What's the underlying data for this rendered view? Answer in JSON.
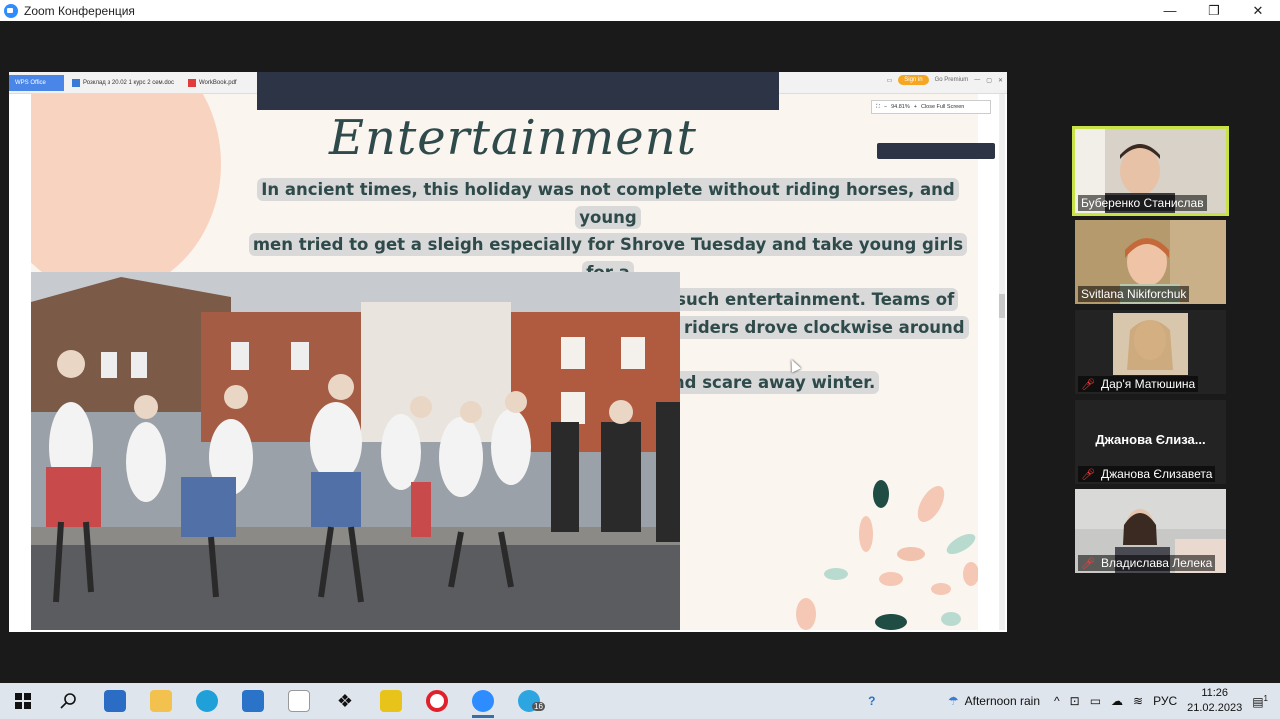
{
  "window": {
    "title": "Zoom Конференция",
    "controls": [
      "—",
      "❐",
      "✕"
    ]
  },
  "wps": {
    "tabs": [
      {
        "label": "WPS Office"
      },
      {
        "label": "Розклад з 20.02 1 курс 2 сем.doc"
      },
      {
        "label": "WorkBook.pdf"
      }
    ],
    "sign_in": "Sign in",
    "premium": "Go Premium",
    "zoom_level": "94.81%",
    "close_fullscreen": "Close Full Screen"
  },
  "slide": {
    "title": "Entertainment",
    "lines": [
      "In ancient times, this holiday was not complete without riding horses, and young",
      "men tried to get a sleigh especially for Shrove Tuesday and take young girls for a",
      "ride.  Young couples necessarily took part in such entertainment.  Teams of",
      "horses with bells and cheerful laughter of the riders drove clockwise around the",
      "villages, trying to wake up nature and scare away winter."
    ]
  },
  "participants": [
    {
      "name": "Буберенко Станислав",
      "muted": false,
      "active": true
    },
    {
      "name": "Svitlana Nikiforchuk",
      "muted": false,
      "active": false
    },
    {
      "name": "Дар'я Матюшина",
      "muted": true,
      "active": false
    },
    {
      "name": "Джанова Єлизавета",
      "display": "Джанова Єлиза...",
      "muted": true,
      "active": false
    },
    {
      "name": "Владислава Лелека",
      "muted": true,
      "active": false
    }
  ],
  "taskbar": {
    "weather": "Afternoon rain",
    "language": "РУС",
    "time": "11:26",
    "date": "21.02.2023",
    "badge": "16",
    "notification_count": "1"
  }
}
